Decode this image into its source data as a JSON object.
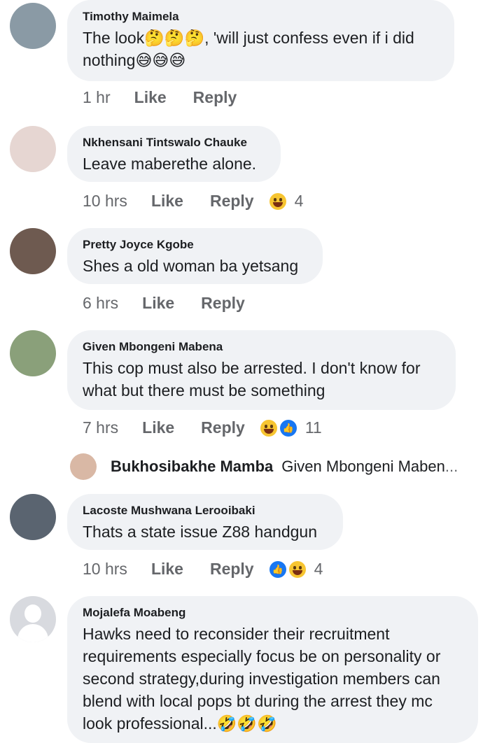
{
  "comments": [
    {
      "name": "Timothy Maimela",
      "text_lines": [
        "The look🤔🤔🤔, 'will just confess even if i did",
        "nothing😅😅😅"
      ],
      "time": "1 hr",
      "like": "Like",
      "reply": "Reply",
      "reaction_count": "",
      "avatar_color": "#8a9aa5"
    },
    {
      "name": "Nkhensani Tintswalo Chauke",
      "text_lines": [
        "Leave maberethe alone."
      ],
      "time": "10 hrs",
      "like": "Like",
      "reply": "Reply",
      "reaction_count": "4",
      "avatar_color": "#e6d6d2"
    },
    {
      "name": "Pretty Joyce Kgobe",
      "text_lines": [
        "Shes a old woman ba yetsang"
      ],
      "time": "6 hrs",
      "like": "Like",
      "reply": "Reply",
      "reaction_count": "",
      "avatar_color": "#6e5a50"
    },
    {
      "name": "Given Mbongeni Mabena",
      "text_lines": [
        "This cop must also be arrested. I don't know for",
        "what but there must be something"
      ],
      "time": "7 hrs",
      "like": "Like",
      "reply": "Reply",
      "reaction_count": "11",
      "avatar_color": "#8aa07a"
    },
    {
      "name": "Lacoste Mushwana Lerooibaki",
      "text_lines": [
        "Thats a state issue Z88 handgun"
      ],
      "time": "10 hrs",
      "like": "Like",
      "reply": "Reply",
      "reaction_count": "4",
      "avatar_color": "#5a6470"
    },
    {
      "name": "Mojalefa Moabeng",
      "text_lines": [
        "Hawks need to reconsider their recruitment",
        "requirements especially focus be on personality or",
        "second strategy,during investigation members can",
        "blend with local pops bt during the arrest they mc",
        "look professional...🤣🤣🤣"
      ],
      "time": "",
      "like": "",
      "reply": "",
      "reaction_count": ""
    }
  ],
  "reply_preview": {
    "name": "Bukhosibakhe Mamba",
    "text": "Given Mbongeni Maben",
    "ellipsis": "..."
  },
  "icons": {
    "laugh": "haha-reaction-icon",
    "like": "like-reaction-icon",
    "avatar_placeholder": "default-avatar-icon"
  },
  "colors": {
    "bubble": "#f0f2f5",
    "meta": "#65676b",
    "like_blue": "#1877f2"
  }
}
